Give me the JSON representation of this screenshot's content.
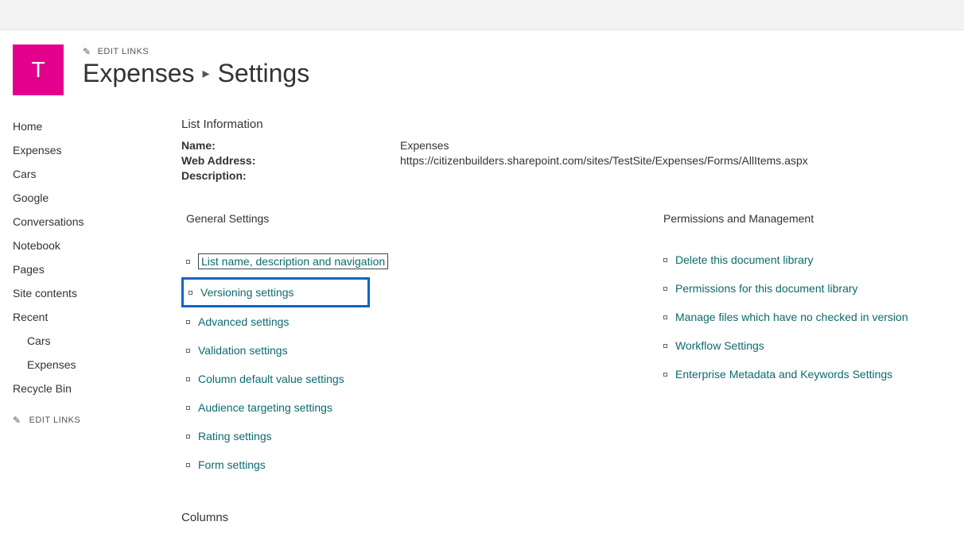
{
  "header": {
    "logo_letter": "T",
    "edit_links_label": "EDIT LINKS",
    "breadcrumb_list": "Expenses",
    "breadcrumb_page": "Settings"
  },
  "nav": {
    "items": [
      "Home",
      "Expenses",
      "Cars",
      "Google",
      "Conversations",
      "Notebook",
      "Pages",
      "Site contents",
      "Recent",
      "Recycle Bin"
    ],
    "recent": [
      "Cars",
      "Expenses"
    ],
    "edit_links_label": "EDIT LINKS"
  },
  "list_info": {
    "heading": "List Information",
    "name_label": "Name:",
    "name_value": "Expenses",
    "address_label": "Web Address:",
    "address_value": "https://citizenbuilders.sharepoint.com/sites/TestSite/Expenses/Forms/AllItems.aspx",
    "description_label": "Description:",
    "description_value": ""
  },
  "general": {
    "heading": "General Settings",
    "items": [
      "List name, description and navigation",
      "Versioning settings",
      "Advanced settings",
      "Validation settings",
      "Column default value settings",
      "Audience targeting settings",
      "Rating settings",
      "Form settings"
    ]
  },
  "permissions": {
    "heading": "Permissions and Management",
    "items": [
      "Delete this document library",
      "Permissions for this document library",
      "Manage files which have no checked in version",
      "Workflow Settings",
      "Enterprise Metadata and Keywords Settings"
    ]
  },
  "columns": {
    "heading": "Columns"
  },
  "colors": {
    "brand": "#e3008c",
    "link": "#0b6a6f",
    "highlight": "#0a66c2"
  }
}
